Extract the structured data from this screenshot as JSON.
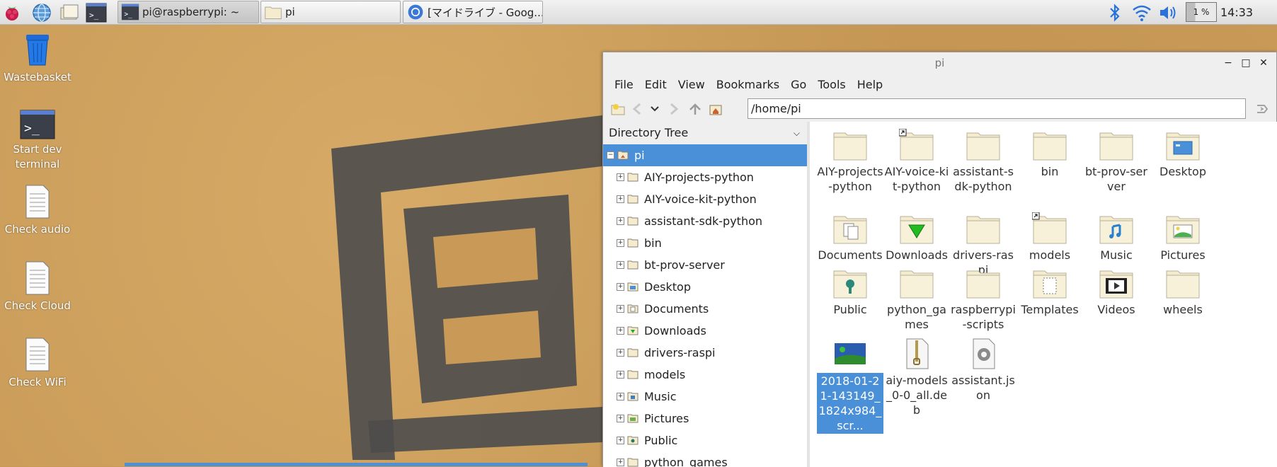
{
  "taskbar": {
    "tasks": [
      {
        "label": "pi@raspberrypi: ~"
      },
      {
        "label": "pi"
      },
      {
        "label": "[マイドライブ - Goog..."
      }
    ],
    "cpu": "1 %",
    "clock": "14:33"
  },
  "desktop": {
    "icons": [
      {
        "label": "Wastebasket"
      },
      {
        "label": "Start dev terminal"
      },
      {
        "label": "Check audio"
      },
      {
        "label": "Check Cloud"
      },
      {
        "label": "Check WiFi"
      }
    ]
  },
  "filemanager": {
    "title": "pi",
    "menu": [
      "File",
      "Edit",
      "View",
      "Bookmarks",
      "Go",
      "Tools",
      "Help"
    ],
    "path": "/home/pi",
    "sidebar_title": "Directory Tree",
    "tree": [
      {
        "label": "pi"
      },
      {
        "label": "AIY-projects-python"
      },
      {
        "label": "AIY-voice-kit-python"
      },
      {
        "label": "assistant-sdk-python"
      },
      {
        "label": "bin"
      },
      {
        "label": "bt-prov-server"
      },
      {
        "label": "Desktop"
      },
      {
        "label": "Documents"
      },
      {
        "label": "Downloads"
      },
      {
        "label": "drivers-raspi"
      },
      {
        "label": "models"
      },
      {
        "label": "Music"
      },
      {
        "label": "Pictures"
      },
      {
        "label": "Public"
      },
      {
        "label": "python_games"
      }
    ],
    "items": [
      {
        "label": "AIY-projects-python"
      },
      {
        "label": "AIY-voice-kit-python"
      },
      {
        "label": "assistant-sdk-python"
      },
      {
        "label": "bin"
      },
      {
        "label": "bt-prov-server"
      },
      {
        "label": "Desktop"
      },
      {
        "label": "Documents"
      },
      {
        "label": "Downloads"
      },
      {
        "label": "drivers-raspi"
      },
      {
        "label": "models"
      },
      {
        "label": "Music"
      },
      {
        "label": "Pictures"
      },
      {
        "label": "Public"
      },
      {
        "label": "python_games"
      },
      {
        "label": "raspberrypi-scripts"
      },
      {
        "label": "Templates"
      },
      {
        "label": "Videos"
      },
      {
        "label": "wheels"
      },
      {
        "label": "2018-01-21-143149_1824x984_scr..."
      },
      {
        "label": "aiy-models_0-0_all.deb"
      },
      {
        "label": "assistant.json"
      }
    ]
  }
}
